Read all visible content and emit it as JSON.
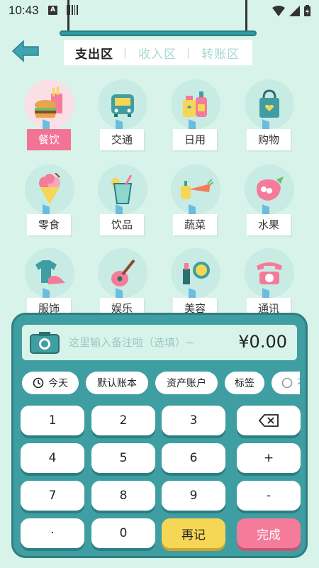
{
  "status": {
    "time": "10:43",
    "a_badge": "A"
  },
  "tabs": {
    "items": [
      "支出区",
      "收入区",
      "转账区"
    ],
    "active": 0
  },
  "categories": [
    {
      "label": "餐饮",
      "icon": "burger-drink-icon",
      "selected": true
    },
    {
      "label": "交通",
      "icon": "bus-icon"
    },
    {
      "label": "日用",
      "icon": "daily-bottles-icon"
    },
    {
      "label": "购物",
      "icon": "shopping-bag-icon"
    },
    {
      "label": "零食",
      "icon": "ice-cream-icon"
    },
    {
      "label": "饮品",
      "icon": "drink-cup-icon"
    },
    {
      "label": "蔬菜",
      "icon": "carrot-pepper-icon"
    },
    {
      "label": "水果",
      "icon": "strawberry-icon"
    },
    {
      "label": "服饰",
      "icon": "tshirt-shoe-icon"
    },
    {
      "label": "娱乐",
      "icon": "guitar-icon"
    },
    {
      "label": "美容",
      "icon": "makeup-icon"
    },
    {
      "label": "通讯",
      "icon": "telephone-icon"
    }
  ],
  "keypad": {
    "note_placeholder": "这里输入备注啦（选填）~",
    "amount": "¥0.00",
    "chips": {
      "today": "今天",
      "book": "默认账本",
      "account": "资产账户",
      "tag": "标签",
      "more": "不"
    },
    "keys": {
      "k1": "1",
      "k2": "2",
      "k3": "3",
      "k4": "4",
      "k5": "5",
      "k6": "6",
      "plus": "+",
      "k7": "7",
      "k8": "8",
      "k9": "9",
      "minus": "-",
      "dot": "·",
      "k0": "0",
      "again": "再记",
      "done": "完成"
    }
  },
  "colors": {
    "background": "#d8f3ea",
    "panel": "#3f9ea1",
    "selected": "#f27394",
    "again": "#f6d655",
    "done": "#f47b9a"
  }
}
